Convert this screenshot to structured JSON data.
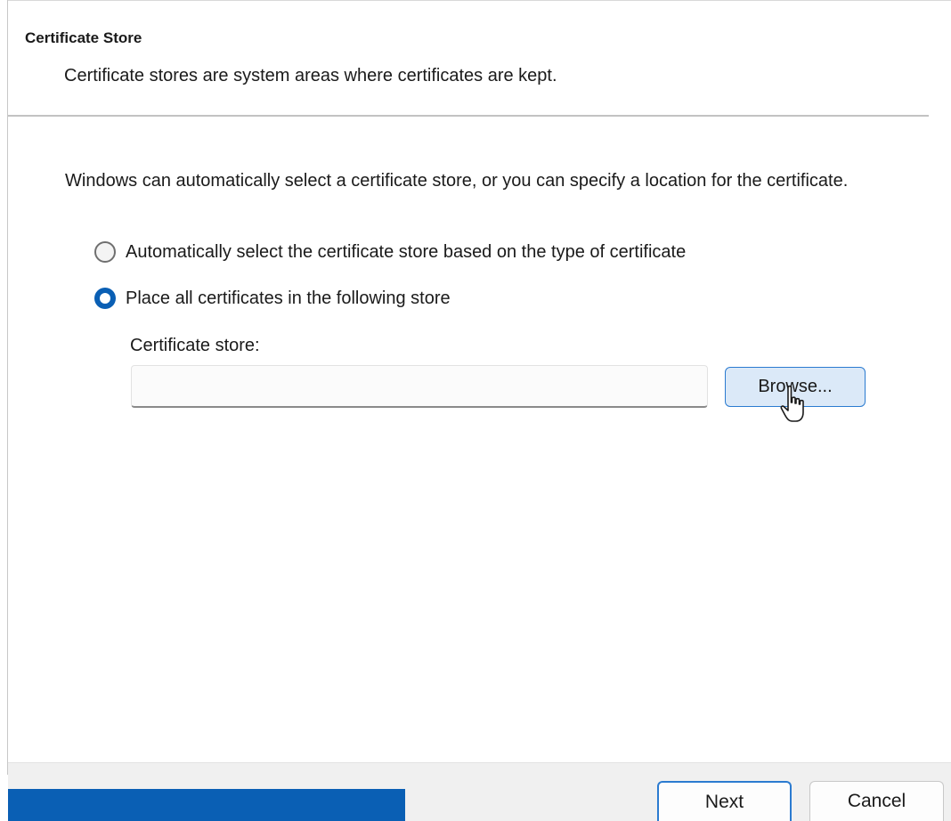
{
  "header": {
    "title": "Certificate Store",
    "subtitle": "Certificate stores are system areas where certificates are kept."
  },
  "body": {
    "intro": "Windows can automatically select a certificate store, or you can specify a location for the certificate.",
    "options": [
      {
        "label": "Automatically select the certificate store based on the type of certificate",
        "selected": false
      },
      {
        "label": "Place all certificates in the following store",
        "selected": true
      }
    ],
    "store_label": "Certificate store:",
    "store_value": "",
    "browse_label": "Browse..."
  },
  "footer": {
    "next_label": "Next",
    "cancel_label": "Cancel"
  },
  "colors": {
    "accent": "#0a5fb4",
    "browse_bg": "#dbe9f8"
  },
  "icons": {
    "cursor": "hand-pointer-cursor-icon"
  }
}
